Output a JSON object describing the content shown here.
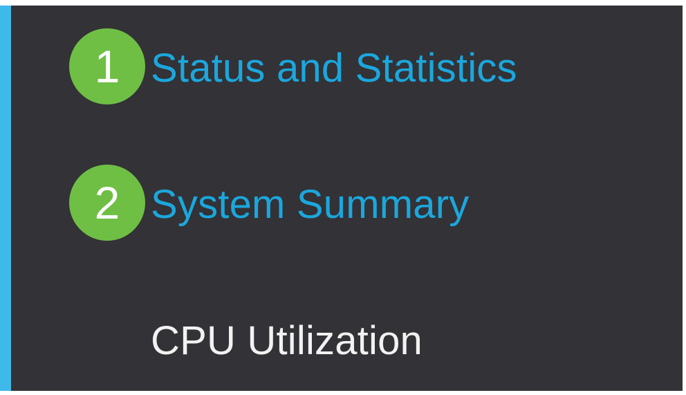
{
  "colors": {
    "panel_background": "#333236",
    "accent_bar": "#3fb8ea",
    "link_text": "#1ba7dd",
    "plain_text": "#f2f2f2",
    "step_badge": "#6fbf45"
  },
  "nav": {
    "items": [
      {
        "step": "1",
        "label": "Status and Statistics"
      },
      {
        "step": "2",
        "label": "System Summary"
      },
      {
        "label": "CPU Utilization"
      }
    ]
  }
}
